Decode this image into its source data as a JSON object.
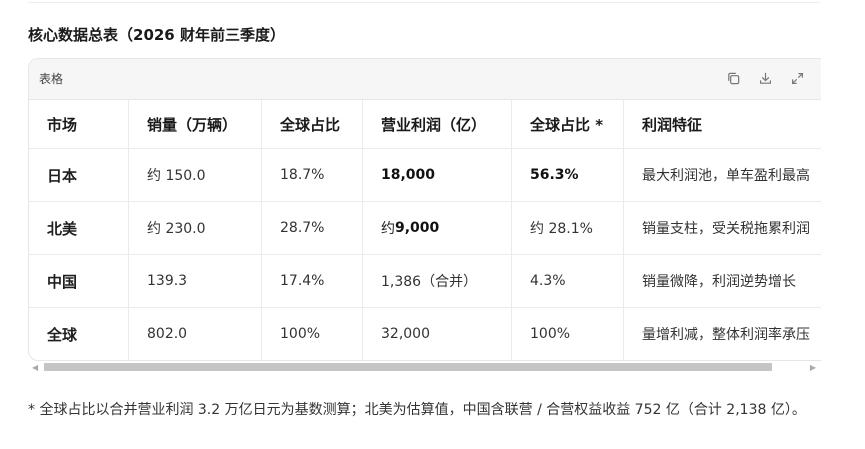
{
  "heading": "核心数据总表（2026 财年前三季度）",
  "card": {
    "label": "表格",
    "tools": [
      "copy-icon",
      "download-icon",
      "expand-icon"
    ]
  },
  "table": {
    "headers": [
      "市场",
      "销量（万辆）",
      "全球占比",
      "营业利润（亿）",
      "全球占比 *",
      "利润特征"
    ],
    "rows": [
      [
        "日本",
        "约 150.0",
        "18.7%",
        "18,000",
        "56.3%",
        "最大利润池，单车盈利最高"
      ],
      [
        "北美",
        "约 230.0",
        "28.7%",
        [
          "约",
          "9,000"
        ],
        "约 28.1%",
        "销量支柱，受关税拖累利润"
      ],
      [
        "中国",
        "139.3",
        "17.4%",
        "1,386（合并）",
        "4.3%",
        "销量微降，利润逆势增长"
      ],
      [
        "全球",
        "802.0",
        "100%",
        "32,000",
        "100%",
        "量增利减，整体利润率承压"
      ]
    ]
  },
  "note": "* 全球占比以合并营业利润 3.2 万亿日元为基数测算；北美为估算值，中国含联营 / 合营权益收益 752 亿（合计 2,138 亿）。"
}
